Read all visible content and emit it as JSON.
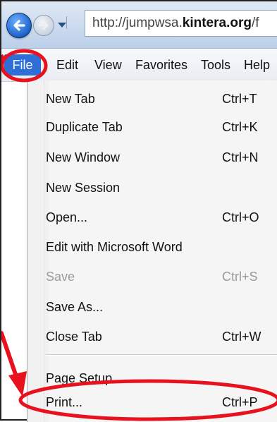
{
  "browser": {
    "address_prefix": "http://jumpwsa.",
    "address_domain": "kintera.org",
    "address_suffix": "/f"
  },
  "menubar": {
    "file": "File",
    "edit": "Edit",
    "view": "View",
    "favorites": "Favorites",
    "tools": "Tools",
    "help": "Help"
  },
  "file_menu": {
    "items": [
      {
        "label": "New Tab",
        "shortcut": "Ctrl+T"
      },
      {
        "label": "Duplicate Tab",
        "shortcut": "Ctrl+K"
      },
      {
        "label": "New Window",
        "shortcut": "Ctrl+N"
      },
      {
        "label": "New Session",
        "shortcut": ""
      },
      {
        "label": "Open...",
        "shortcut": "Ctrl+O"
      },
      {
        "label": "Edit with Microsoft Word",
        "shortcut": ""
      },
      {
        "label": "Save",
        "shortcut": "Ctrl+S",
        "disabled": true
      },
      {
        "label": "Save As...",
        "shortcut": ""
      },
      {
        "label": "Close Tab",
        "shortcut": "Ctrl+W"
      },
      {
        "label": "Page Setup...",
        "shortcut": ""
      },
      {
        "label": "Print...",
        "shortcut": "Ctrl+P"
      }
    ]
  },
  "colors": {
    "highlight": "#e8121e",
    "menu_selected": "#2d6fd6"
  }
}
